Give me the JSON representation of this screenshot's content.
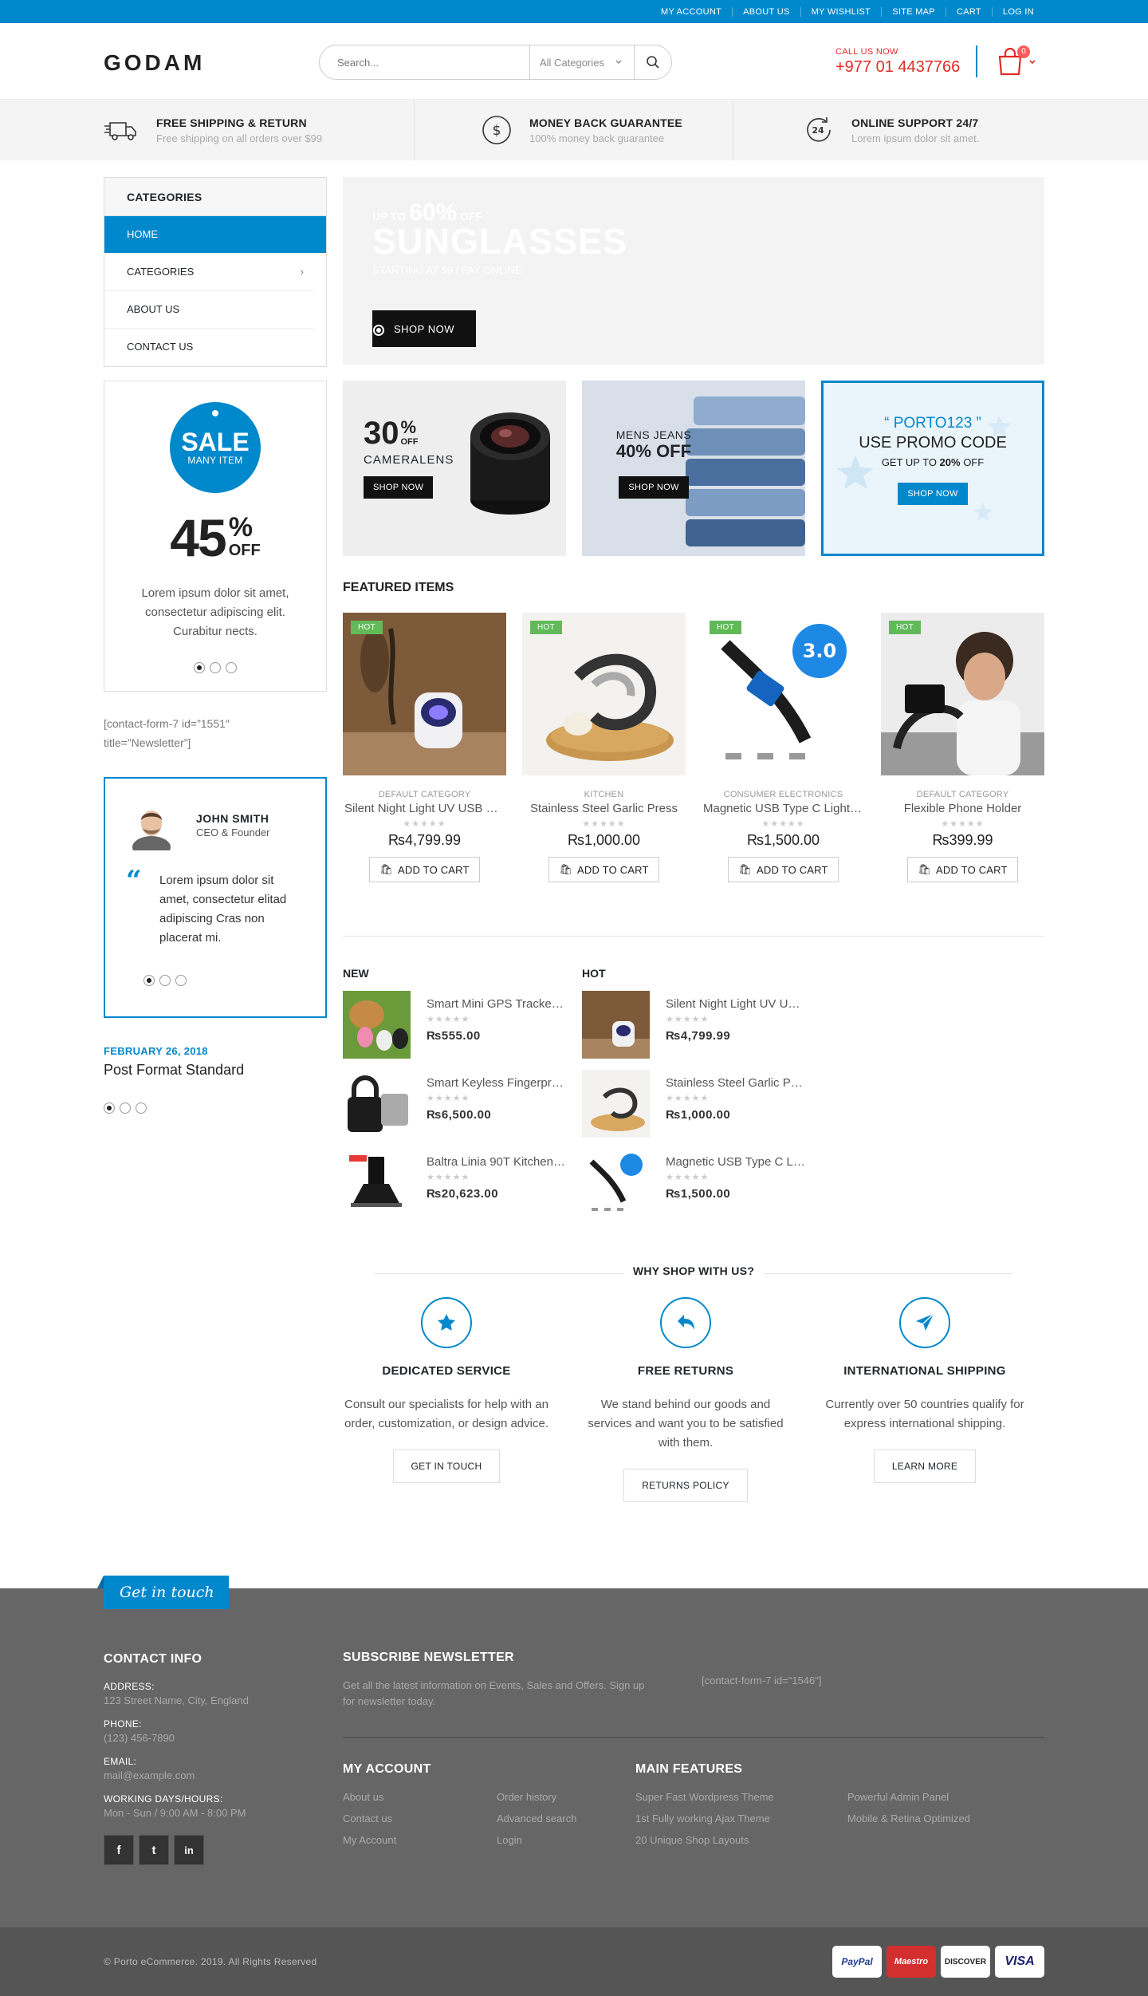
{
  "topbar": {
    "links": [
      "MY ACCOUNT",
      "ABOUT US",
      "MY WISHLIST",
      "SITE MAP",
      "CART",
      "LOG IN"
    ]
  },
  "header": {
    "logo": "GODAM",
    "search_placeholder": "Search...",
    "category_select": "All Categories",
    "call_label": "CALL US NOW",
    "phone": "+977 01 4437766",
    "cart_count": "0"
  },
  "info": [
    {
      "title": "FREE SHIPPING & RETURN",
      "sub": "Free shipping on all orders over $99",
      "icon": "truck-icon"
    },
    {
      "title": "MONEY BACK GUARANTEE",
      "sub": "100% money back guarantee",
      "icon": "dollar-icon"
    },
    {
      "title": "ONLINE SUPPORT 24/7",
      "sub": "Lorem ipsum dolor sit amet.",
      "icon": "support-24-icon"
    }
  ],
  "categories": {
    "title": "CATEGORIES",
    "items": [
      "HOME",
      "CATEGORIES",
      "ABOUT US",
      "CONTACT US"
    ]
  },
  "hero": {
    "up_to": "UP TO",
    "percent": "60%",
    "off": "OFF",
    "title": "SUNGLASSES",
    "sub": "STARTING AT $9 / PAY ONLINE",
    "button": "SHOP NOW"
  },
  "banners": {
    "camera": {
      "pct": "30",
      "sym": "%",
      "off": "OFF",
      "name": "CAMERALENS",
      "button": "SHOP NOW"
    },
    "jeans": {
      "line1": "MENS JEANS",
      "line2": "40% OFF",
      "button": "SHOP NOW"
    },
    "promo": {
      "code": "“ PORTO123 ”",
      "line1": "USE PROMO CODE",
      "line2a": "GET UP TO ",
      "line2b": "20%",
      "line2c": " OFF",
      "button": "SHOP NOW"
    }
  },
  "sale": {
    "title": "SALE",
    "sub": "MANY ITEM",
    "pct": "45",
    "pct_sym": "%",
    "off": "OFF",
    "text": "Lorem ipsum dolor sit amet, consectetur adipiscing elit. Curabitur nects."
  },
  "contact_form": "[contact-form-7 id=”1551″ title=”Newsletter”]",
  "testimonial": {
    "name": "JOHN SMITH",
    "role": "CEO & Founder",
    "quote": "Lorem ipsum dolor sit amet, consectetur elitad adipiscing Cras non placerat mi."
  },
  "post": {
    "date": "FEBRUARY 26, 2018",
    "title": "Post Format Standard"
  },
  "featured": {
    "title": "FEATURED ITEMS",
    "hot_label": "HOT",
    "add_to_cart": "ADD TO CART",
    "products": [
      {
        "category": "DEFAULT CATEGORY",
        "name": "Silent Night Light UV USB M...",
        "price": "₨4,799.99"
      },
      {
        "category": "KITCHEN",
        "name": "Stainless Steel Garlic Press",
        "price": "₨1,000.00"
      },
      {
        "category": "CONSUMER ELECTRONICS",
        "name": "Magnetic USB Type C Lightin...",
        "price": "₨1,500.00"
      },
      {
        "category": "DEFAULT CATEGORY",
        "name": "Flexible Phone Holder",
        "price": "₨399.99"
      }
    ]
  },
  "new_list": {
    "title": "NEW",
    "items": [
      {
        "name": "Smart Mini GPS Tracker ...",
        "price": "₨555.00"
      },
      {
        "name": "Smart Keyless Fingerprin...",
        "price": "₨6,500.00"
      },
      {
        "name": "Baltra Linia 90T Kitchen ...",
        "price": "₨20,623.00"
      }
    ]
  },
  "hot_list": {
    "title": "HOT",
    "items": [
      {
        "name": "Silent Night Light UV US...",
        "price": "₨4,799.99"
      },
      {
        "name": "Stainless Steel Garlic Press",
        "price": "₨1,000.00"
      },
      {
        "name": "Magnetic USB Type C Li...",
        "price": "₨1,500.00"
      }
    ]
  },
  "why": {
    "title": "WHY SHOP WITH US?",
    "cols": [
      {
        "title": "DEDICATED SERVICE",
        "desc": "Consult our specialists for help with an order, customization, or design advice.",
        "button": "GET IN TOUCH",
        "icon": "star-icon"
      },
      {
        "title": "FREE RETURNS",
        "desc": "We stand behind our goods and services and want you to be satisfied with them.",
        "button": "RETURNS POLICY",
        "icon": "return-icon"
      },
      {
        "title": "INTERNATIONAL SHIPPING",
        "desc": "Currently over 50 countries qualify for express international shipping.",
        "button": "LEARN MORE",
        "icon": "paper-plane-icon"
      }
    ]
  },
  "footer": {
    "get_in_touch": "Get in touch",
    "contact_title": "CONTACT INFO",
    "address_label": "ADDRESS:",
    "address": "123 Street Name, City, England",
    "phone_label": "PHONE:",
    "phone": "(123) 456-7890",
    "email_label": "EMAIL:",
    "email": "mail@example.com",
    "hours_label": "WORKING DAYS/HOURS:",
    "hours": "Mon - Sun / 9:00 AM - 8:00 PM",
    "newsletter_title": "SUBSCRIBE NEWSLETTER",
    "newsletter_text": "Get all the latest information on Events, Sales and Offers. Sign up for newsletter today.",
    "newsletter_form": "[contact-form-7 id=\"1546\"]",
    "account_title": "MY ACCOUNT",
    "account_links": [
      "About us",
      "Contact us",
      "My Account",
      "Order history",
      "Advanced search",
      "Login"
    ],
    "features_title": "MAIN FEATURES",
    "features_links": [
      "Super Fast Wordpress Theme",
      "1st Fully working Ajax Theme",
      "20 Unique Shop Layouts",
      "Powerful Admin Panel",
      "Mobile & Retina Optimized"
    ],
    "copyright": "© Porto eCommerce. 2019. All Rights Reserved",
    "social": [
      "f",
      "t",
      "in"
    ],
    "payments": [
      "PayPal",
      "Maestro",
      "DISCOVER",
      "VISA"
    ]
  },
  "colors": {
    "accent": "#0088cc",
    "hot": "#62b959",
    "call": "#e02b27",
    "footer": "#666666"
  }
}
